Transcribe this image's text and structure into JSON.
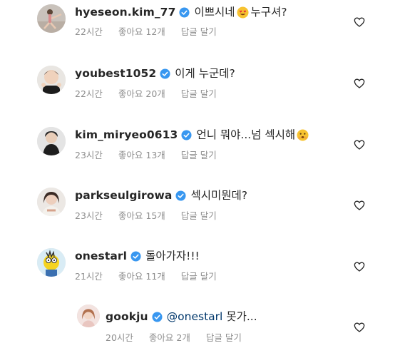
{
  "colors": {
    "username": "#262626",
    "meta": "#8e8e8e",
    "verified": "#3897f0",
    "mention": "#00376b"
  },
  "comments": [
    {
      "username": "hyeseon.kim_77",
      "text": "이쁘시네",
      "emoji": "heart-eyes-emoji",
      "text_after": "누구셔?",
      "time": "22시간",
      "likes": "좋아요 12개",
      "reply": "답글 달기"
    },
    {
      "username": "youbest1052",
      "text": "이게 누군데?",
      "time": "22시간",
      "likes": "좋아요 20개",
      "reply": "답글 달기"
    },
    {
      "username": "kim_miryeo0613",
      "text": "언니 뭐야...넘 섹시해",
      "emoji": "shushing-face-emoji",
      "time": "23시간",
      "likes": "좋아요 13개",
      "reply": "답글 달기"
    },
    {
      "username": "parkseulgirowa",
      "text": "섹시미뭔데?",
      "time": "23시간",
      "likes": "좋아요 15개",
      "reply": "답글 달기"
    },
    {
      "username": "onestarl",
      "text": "돌아가자!!!",
      "time": "21시간",
      "likes": "좋아요 11개",
      "reply": "답글 달기"
    },
    {
      "username": "gookju",
      "mention": "@onestarl",
      "text": "못가...",
      "time": "20시간",
      "likes": "좋아요 2개",
      "reply": "답글 달기"
    }
  ]
}
